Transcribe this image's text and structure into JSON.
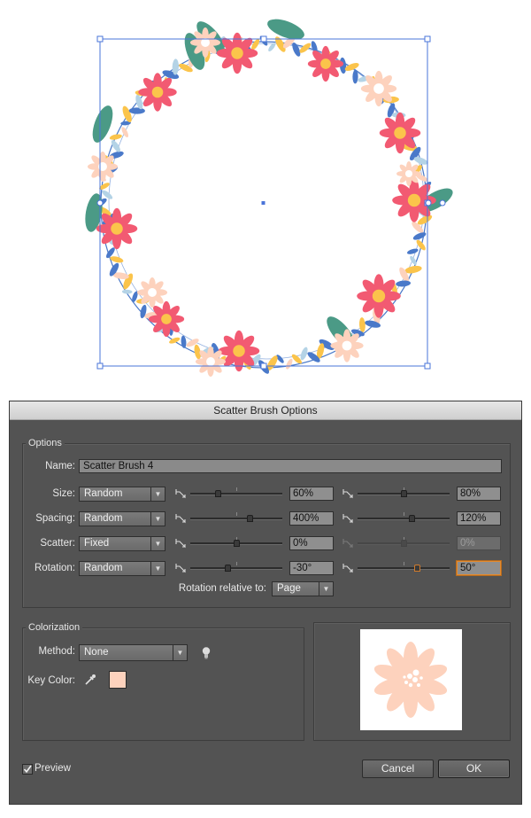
{
  "dialog": {
    "title": "Scatter Brush Options",
    "options_legend": "Options",
    "name_label": "Name:",
    "name_value": "Scatter Brush 4",
    "rows": [
      {
        "label": "Size:",
        "method": "Random",
        "min": "60%",
        "max": "80%",
        "min_pos": 0.3,
        "max_pos": 0.5
      },
      {
        "label": "Spacing:",
        "method": "Random",
        "min": "400%",
        "max": "120%",
        "min_pos": 0.64,
        "max_pos": 0.59
      },
      {
        "label": "Scatter:",
        "method": "Fixed",
        "min": "0%",
        "max": "0%",
        "min_pos": 0.5,
        "max_pos": 0.5
      },
      {
        "label": "Rotation:",
        "method": "Random",
        "min": "-30°",
        "max": "50°",
        "min_pos": 0.4,
        "max_pos": 0.64
      }
    ],
    "rotation_relative_label": "Rotation relative to:",
    "rotation_relative_value": "Page",
    "colorization_legend": "Colorization",
    "method_label": "Method:",
    "method_value": "None",
    "key_color_label": "Key Color:",
    "key_color": "#fdd2bd",
    "preview_label": "Preview",
    "preview_checked": true,
    "cancel_label": "Cancel",
    "ok_label": "OK"
  },
  "colors": {
    "selection": "#4a74d9",
    "flower_pink": "#f25a72",
    "flower_peach": "#fdd2bd",
    "leaf_blue": "#4a79c9",
    "leaf_light_blue": "#b4d3e6",
    "leaf_yellow": "#fbc44b",
    "leaf_green": "#4b9a86",
    "dialog_bg": "#535353"
  },
  "icons": [
    "eyedropper-icon",
    "tips-bulb-icon",
    "checkbox-check-icon",
    "fixed-variation-icon"
  ]
}
